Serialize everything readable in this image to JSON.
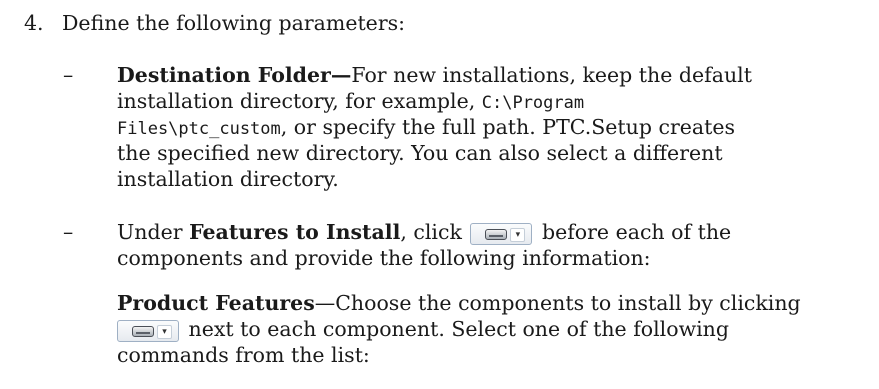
{
  "step": {
    "number": "4.",
    "text": "Define the following parameters:"
  },
  "bullet1": {
    "dash": "–",
    "l1_bold": "Destination Folder—",
    "l1_text": "For new installations, keep the default",
    "l2_text": "installation directory, for example, ",
    "l2_code": "C:\\Program",
    "l3_code": "Files\\ptc_custom",
    "l3_text": ", or specify the full path. PTC.Setup creates",
    "l4_text": "the specified new directory. You can also select a different",
    "l5_text": "installation directory."
  },
  "bullet2": {
    "dash": "–",
    "l1_pre": "Under ",
    "l1_bold": "Features to Install",
    "l1_mid": ", click",
    "l1_post": "before each of the",
    "l2_text": "components and provide the following information:",
    "icon": "drive-dropdown-icon"
  },
  "product_features": {
    "l1_bold": "Product Features",
    "l1_text": "—Choose the components to install by clicking",
    "l2_post": "next to each component. Select one of the following",
    "l3_text": "commands from the list:",
    "icon": "drive-dropdown-icon"
  }
}
